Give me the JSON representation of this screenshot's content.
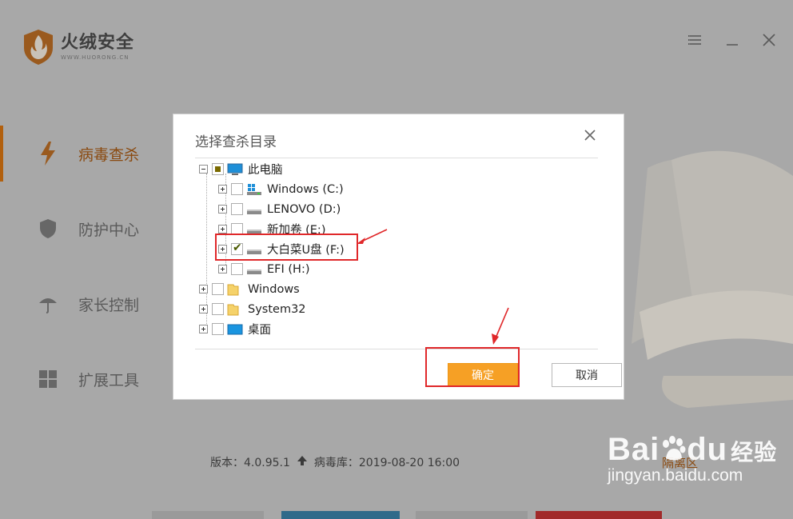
{
  "app": {
    "name": "火绒安全",
    "url": "WWW.HUORONG.CN",
    "nav": [
      {
        "label": "病毒查杀",
        "icon": "lightning-icon",
        "active": true
      },
      {
        "label": "防护中心",
        "icon": "shield-icon",
        "active": false
      },
      {
        "label": "家长控制",
        "icon": "umbrella-icon",
        "active": false
      },
      {
        "label": "扩展工具",
        "icon": "grid-icon",
        "active": false
      }
    ],
    "version_label": "版本：4.0.95.1",
    "virus_db_label": "病毒库：2019-08-20 16:00",
    "quarantine_label": "隔离区"
  },
  "dialog": {
    "title": "选择查杀目录",
    "tree": [
      {
        "label": "此电脑",
        "icon": "computer-icon",
        "state": "partial"
      },
      {
        "label": "Windows (C:)",
        "icon": "windows-drive-icon",
        "state": "unchecked"
      },
      {
        "label": "LENOVO (D:)",
        "icon": "drive-icon",
        "state": "unchecked"
      },
      {
        "label": "新加卷 (E:)",
        "icon": "drive-icon",
        "state": "unchecked"
      },
      {
        "label": "大白菜U盘 (F:)",
        "icon": "drive-icon",
        "state": "checked"
      },
      {
        "label": "EFI (H:)",
        "icon": "drive-icon",
        "state": "unchecked"
      },
      {
        "label": "Windows",
        "icon": "folder-icon",
        "state": "unchecked"
      },
      {
        "label": "System32",
        "icon": "folder-icon",
        "state": "unchecked"
      },
      {
        "label": "桌面",
        "icon": "desktop-icon",
        "state": "unchecked"
      }
    ],
    "ok_label": "确定",
    "cancel_label": "取消"
  },
  "watermark": {
    "brand": "Bai",
    "brand2": "du",
    "brand_cn": "经验",
    "url": "jingyan.baidu.com"
  },
  "colors": {
    "accent": "#f6a025",
    "annotation": "#e0282a",
    "nav_active": "#b2600e"
  }
}
